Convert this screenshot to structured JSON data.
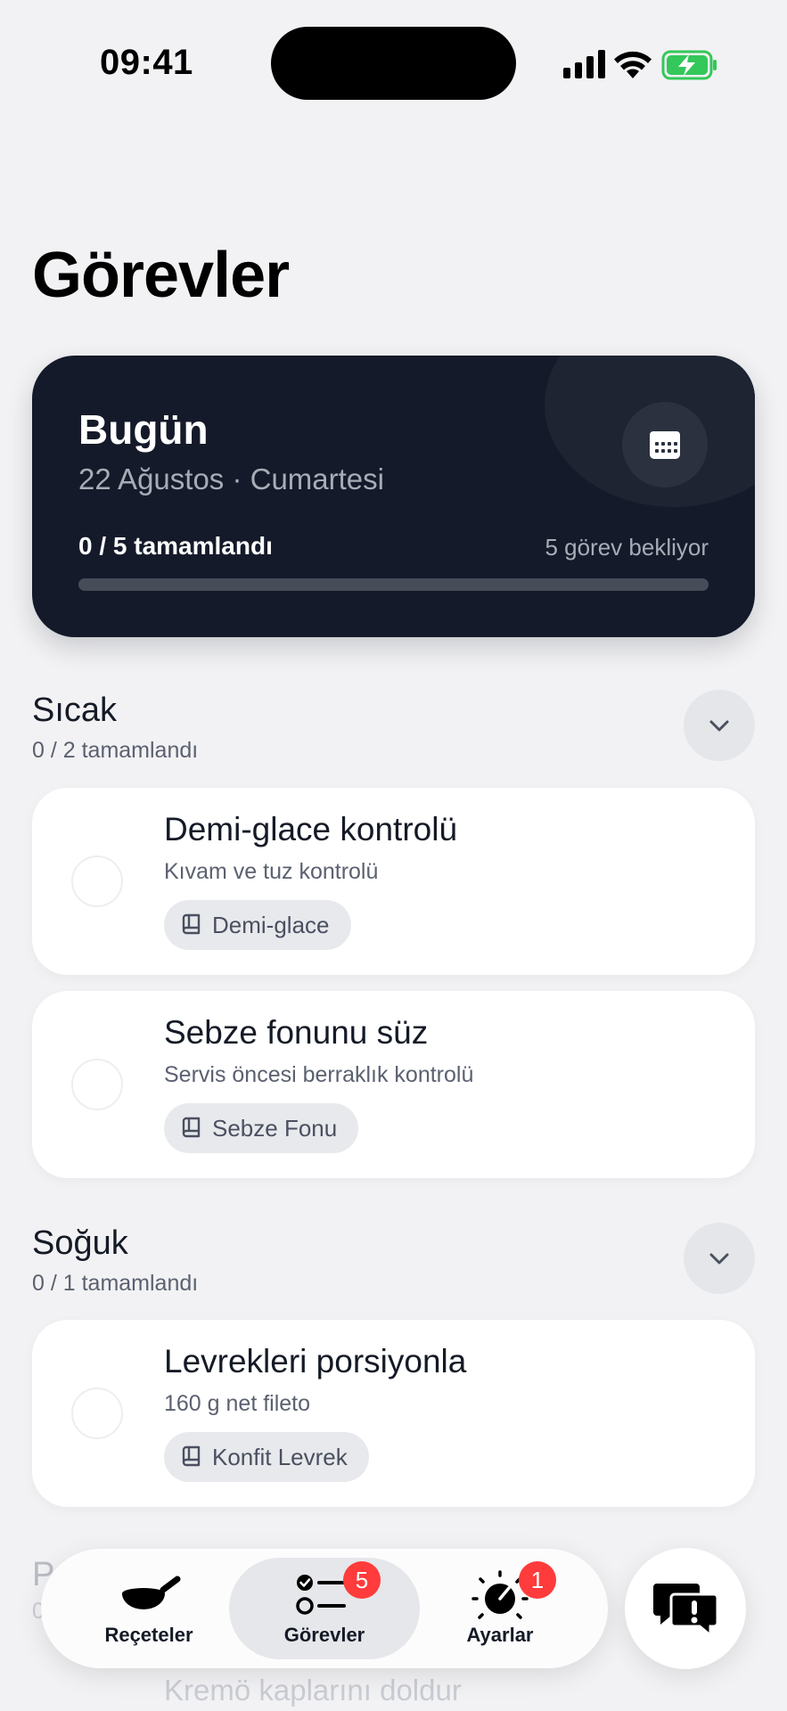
{
  "status": {
    "time": "09:41"
  },
  "page": {
    "title": "Görevler"
  },
  "today": {
    "title": "Bugün",
    "date": "22 Ağustos · Cumartesi",
    "progress_label": "0 / 5 tamamlandı",
    "pending_label": "5 görev bekliyor",
    "progress_fraction": 0
  },
  "sections": [
    {
      "title": "Sıcak",
      "count": "0 / 2 tamamlandı",
      "tasks": [
        {
          "title": "Demi-glace kontrolü",
          "subtitle": "Kıvam ve tuz kontrolü",
          "chip": "Demi-glace"
        },
        {
          "title": "Sebze fonunu süz",
          "subtitle": "Servis öncesi berraklık kontrolü",
          "chip": "Sebze Fonu"
        }
      ]
    },
    {
      "title": "Soğuk",
      "count": "0 / 1 tamamlandı",
      "tasks": [
        {
          "title": "Levrekleri porsiyonla",
          "subtitle": "160 g net fileto",
          "chip": "Konfit Levrek"
        }
      ]
    }
  ],
  "partial": {
    "section_initial": "P",
    "count_initial": "0",
    "task_title": "Kremö kaplarını doldur"
  },
  "tabs": [
    {
      "label": "Reçeteler",
      "icon": "pan-icon",
      "badge": ""
    },
    {
      "label": "Görevler",
      "icon": "checklist-icon",
      "badge": "5"
    },
    {
      "label": "Ayarlar",
      "icon": "gauge-icon",
      "badge": "1"
    }
  ],
  "colors": {
    "dark_card": "#141a29",
    "badge": "#ff3b3b",
    "background": "#f2f2f4"
  }
}
